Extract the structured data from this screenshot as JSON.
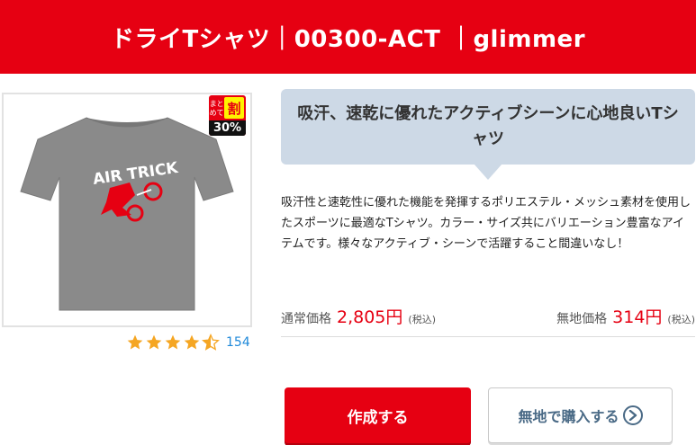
{
  "header": {
    "title": "ドライTシャツ｜00300-ACT ｜glimmer"
  },
  "product": {
    "image_icon": "tshirt-icon",
    "print_text": "AIR TRICK",
    "shirt_color": "#8a8a8a",
    "print_accent": "#e60012",
    "badge": {
      "line1": "まと",
      "line2": "めて",
      "big": "割",
      "percent": "30%"
    }
  },
  "rating": {
    "stars": 4.5,
    "max": 5,
    "count": "154",
    "star_color": "#f5a623"
  },
  "bubble": {
    "text": "吸汗、速乾に優れたアクティブシーンに心地良いTシャツ"
  },
  "description": "吸汗性と速乾性に優れた機能を発揮するポリエステル・メッシュ素材を使用したスポーツに最適なTシャツ。カラー・サイズ共にバリエーション豊富なアイテムです。様々なアクティブ・シーンで活躍すること間違いなし！",
  "prices": {
    "regular": {
      "label": "通常価格",
      "value": "2,805円",
      "tax": "(税込)"
    },
    "plain": {
      "label": "無地価格",
      "value": "314円",
      "tax": "(税込)"
    }
  },
  "buttons": {
    "create_label": "作成する",
    "plain_label": "無地で購入する",
    "plain_icon": "chevron-right-circle-icon"
  },
  "colors": {
    "brand_red": "#e60012",
    "link_blue": "#1e88d9",
    "bubble_bg": "#cdd9e6"
  }
}
